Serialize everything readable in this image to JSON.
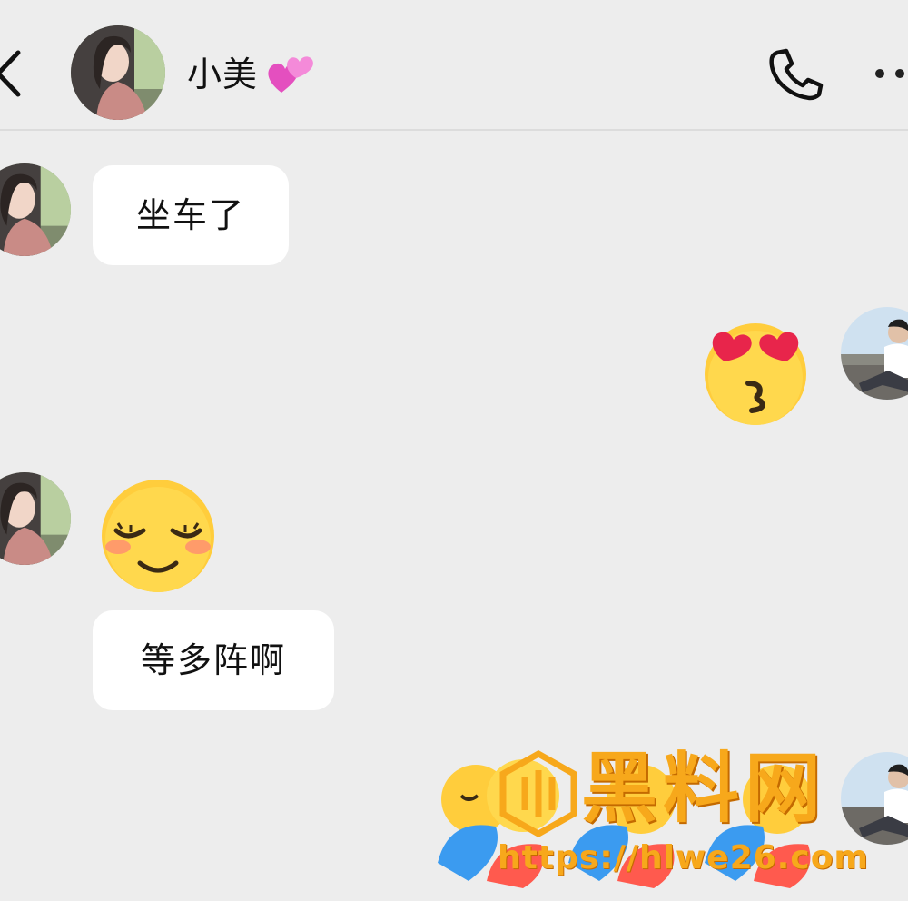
{
  "header": {
    "back_icon": "chevron-left-icon",
    "contact_name": "小美",
    "name_emoji": "pink-hearts-icon",
    "call_icon": "phone-icon",
    "more_icon": "more-dots-icon"
  },
  "messages": [
    {
      "sender": "contact",
      "type": "text",
      "text": "坐车了"
    },
    {
      "sender": "me",
      "type": "sticker",
      "sticker": "heart-eyes-kiss-emoji"
    },
    {
      "sender": "contact",
      "type": "sticker",
      "sticker": "smiling-blush-emoji"
    },
    {
      "sender": "contact",
      "type": "text",
      "text": "等多阵啊"
    },
    {
      "sender": "me",
      "type": "sticker",
      "sticker": "hugging-emoji"
    }
  ],
  "watermark": {
    "title": "黑料网",
    "url": "https://hlwe26.com"
  },
  "colors": {
    "background": "#ededed",
    "bubble": "#ffffff",
    "watermark": "#f7a81b",
    "emoji_yellow": "#ffcd3c",
    "heart_red": "#e8254b"
  }
}
